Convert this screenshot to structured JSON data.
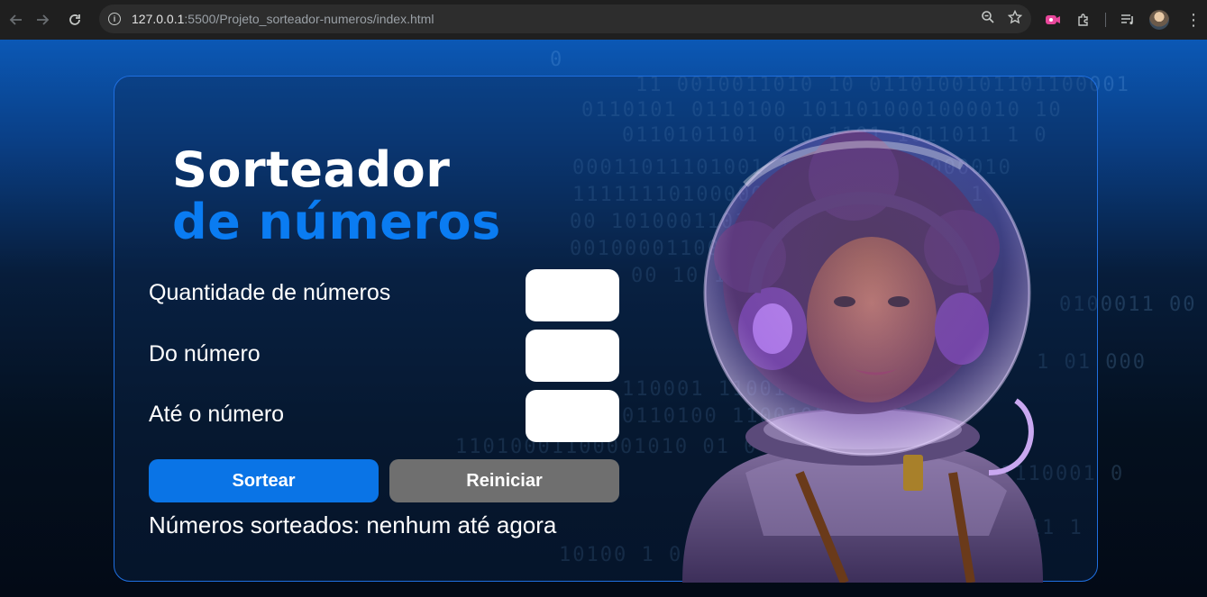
{
  "browser": {
    "url_host": "127.0.0.1",
    "url_path": ":5500/Projeto_sorteador-numeros/index.html"
  },
  "page": {
    "title_line1": "Sorteador",
    "title_line2": "de números",
    "fields": [
      {
        "label": "Quantidade de números",
        "value": ""
      },
      {
        "label": "Do número",
        "value": ""
      },
      {
        "label": "Até o número",
        "value": ""
      }
    ],
    "draw_button": "Sortear",
    "reset_button": "Reiniciar",
    "result_text": "Números sorteados: nenhum até agora"
  },
  "colors": {
    "accent": "#0a74e6",
    "title_highlight": "#0a7cf2",
    "reset_button": "#6f6f6f",
    "card_border": "#1f6fe0"
  },
  "icons": [
    "back-icon",
    "forward-icon",
    "reload-icon",
    "site-info-icon",
    "zoom-icon",
    "bookmark-star-icon",
    "extension-icon",
    "puzzle-icon",
    "media-icon",
    "profile-avatar",
    "menu-icon"
  ]
}
